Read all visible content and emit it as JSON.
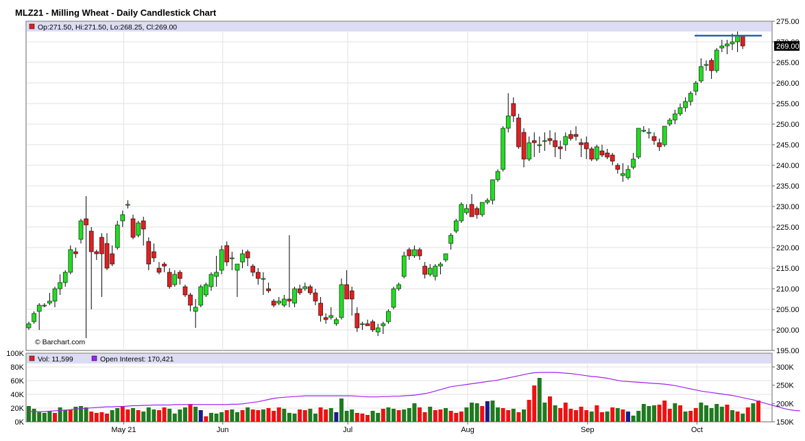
{
  "title": "MLZ21 - Milling Wheat - Daily Candlestick Chart",
  "price_info": "Op:271.50, Hi:271.50, Lo:268.25, Cl:269.00",
  "last_price": "269.00",
  "volume_info": "Vol: 11,599",
  "oi_info": "Open Interest: 170,421",
  "watermark": "© Barchart.com",
  "colors": {
    "up": "#22dd22",
    "down": "#e02020",
    "vol_up": "#1f7a1f",
    "vol_down": "#ee1111",
    "vol_flat": "#1a1a8c",
    "oi": "#a020f0",
    "line": "#2d5fa8",
    "info_band": "#dcdcf5"
  },
  "chart_data": [
    {
      "type": "candlestick",
      "title": "MLZ21 - Milling Wheat - Daily Candlestick Chart",
      "ylim": [
        195,
        275
      ],
      "yticks": [
        "275.00",
        "270.00",
        "265.00",
        "260.00",
        "255.00",
        "250.00",
        "245.00",
        "240.00",
        "235.00",
        "230.00",
        "225.00",
        "220.00",
        "215.00",
        "210.00",
        "205.00",
        "200.00",
        "195.00"
      ],
      "xticks": [
        "May 21",
        "Jun",
        "Jul",
        "Aug",
        "Sep",
        "Oct"
      ],
      "horizontal_line": 271.5,
      "candles": [
        [
          200.5,
          202.0,
          200.0,
          201.5
        ],
        [
          202.0,
          204.5,
          201.5,
          204.0
        ],
        [
          204.5,
          206.5,
          200.0,
          206.0
        ],
        [
          206.0,
          206.5,
          205.5,
          206.0
        ],
        [
          206.5,
          209.0,
          206.0,
          207.0
        ],
        [
          207.0,
          210.5,
          205.5,
          210.0
        ],
        [
          210.0,
          213.5,
          208.5,
          211.5
        ],
        [
          211.5,
          214.5,
          210.5,
          214.0
        ],
        [
          214.0,
          220.5,
          213.5,
          219.5
        ],
        [
          219.0,
          220.0,
          217.5,
          218.5
        ],
        [
          222.0,
          227.0,
          221.0,
          226.5
        ],
        [
          227.0,
          232.5,
          198.0,
          225.5
        ],
        [
          224.0,
          225.0,
          205.0,
          219.0
        ],
        [
          219.0,
          219.5,
          217.0,
          218.5
        ],
        [
          222.5,
          223.5,
          208.0,
          218.5
        ],
        [
          221.0,
          223.5,
          214.5,
          215.0
        ],
        [
          218.5,
          220.5,
          215.5,
          216.0
        ],
        [
          220.0,
          226.5,
          219.5,
          225.5
        ],
        [
          226.5,
          229.0,
          225.0,
          228.0
        ],
        [
          230.5,
          231.5,
          229.5,
          230.5
        ],
        [
          227.0,
          228.0,
          222.0,
          222.5
        ],
        [
          223.0,
          226.5,
          222.5,
          226.0
        ],
        [
          226.5,
          227.5,
          220.5,
          224.5
        ],
        [
          221.5,
          222.5,
          214.5,
          216.0
        ],
        [
          219.0,
          221.0,
          216.5,
          217.5
        ],
        [
          215.0,
          216.5,
          213.5,
          214.0
        ],
        [
          216.0,
          216.5,
          214.0,
          215.5
        ],
        [
          214.0,
          215.0,
          210.0,
          210.5
        ],
        [
          211.0,
          214.5,
          210.5,
          213.5
        ],
        [
          214.0,
          214.5,
          211.0,
          212.5
        ],
        [
          210.5,
          211.0,
          208.0,
          208.5
        ],
        [
          208.5,
          209.0,
          204.5,
          206.0
        ],
        [
          204.5,
          207.5,
          200.5,
          205.5
        ],
        [
          206.0,
          211.0,
          205.5,
          210.5
        ],
        [
          208.5,
          211.5,
          208.0,
          211.0
        ],
        [
          210.5,
          214.0,
          209.5,
          213.5
        ],
        [
          213.0,
          218.0,
          210.5,
          214.0
        ],
        [
          214.5,
          220.5,
          213.5,
          219.5
        ],
        [
          220.5,
          221.5,
          215.5,
          216.5
        ],
        [
          217.5,
          219.0,
          214.5,
          217.5
        ],
        [
          214.5,
          215.5,
          208.0,
          216.0
        ],
        [
          216.5,
          219.5,
          215.0,
          218.5
        ],
        [
          219.0,
          219.5,
          215.5,
          217.5
        ],
        [
          215.5,
          216.0,
          213.0,
          214.0
        ],
        [
          214.0,
          215.0,
          211.0,
          212.5
        ],
        [
          212.5,
          214.0,
          208.5,
          212.5
        ],
        [
          210.0,
          211.5,
          209.0,
          209.5
        ],
        [
          207.0,
          207.5,
          205.5,
          206.0
        ],
        [
          206.5,
          208.0,
          206.0,
          207.0
        ],
        [
          206.0,
          208.5,
          205.5,
          207.5
        ],
        [
          207.5,
          223.0,
          205.5,
          207.0
        ],
        [
          206.5,
          210.5,
          205.5,
          210.0
        ],
        [
          210.0,
          211.0,
          208.5,
          209.0
        ],
        [
          210.0,
          211.5,
          209.5,
          210.5
        ],
        [
          210.5,
          211.0,
          208.5,
          209.0
        ],
        [
          209.0,
          210.0,
          206.0,
          207.0
        ],
        [
          206.5,
          208.0,
          202.0,
          203.5
        ],
        [
          203.0,
          204.0,
          201.5,
          202.5
        ],
        [
          203.0,
          205.5,
          202.5,
          203.5
        ],
        [
          201.5,
          203.0,
          201.0,
          202.5
        ],
        [
          203.0,
          212.5,
          202.5,
          211.0
        ],
        [
          211.0,
          214.5,
          207.5,
          207.5
        ],
        [
          209.5,
          210.5,
          203.5,
          207.5
        ],
        [
          204.0,
          205.5,
          199.5,
          200.5
        ],
        [
          201.5,
          202.0,
          200.0,
          201.5
        ],
        [
          201.5,
          202.5,
          201.0,
          201.0
        ],
        [
          202.0,
          202.5,
          199.5,
          200.0
        ],
        [
          199.5,
          201.5,
          198.5,
          200.5
        ],
        [
          201.0,
          202.0,
          199.0,
          201.5
        ],
        [
          202.0,
          205.0,
          201.5,
          204.5
        ],
        [
          205.5,
          210.5,
          205.0,
          210.0
        ],
        [
          210.0,
          211.5,
          209.5,
          211.0
        ],
        [
          213.0,
          219.0,
          212.5,
          218.0
        ],
        [
          219.5,
          220.0,
          217.0,
          218.0
        ],
        [
          218.0,
          220.5,
          217.5,
          219.5
        ],
        [
          219.5,
          220.0,
          217.0,
          218.0
        ],
        [
          215.5,
          216.5,
          212.5,
          213.5
        ],
        [
          213.5,
          216.0,
          213.0,
          215.0
        ],
        [
          213.0,
          216.0,
          212.0,
          215.5
        ],
        [
          215.5,
          216.5,
          213.5,
          216.0
        ],
        [
          217.0,
          218.5,
          216.5,
          218.5
        ],
        [
          221.0,
          223.5,
          219.5,
          223.0
        ],
        [
          224.0,
          227.0,
          223.5,
          226.5
        ],
        [
          226.5,
          231.0,
          226.0,
          230.5
        ],
        [
          228.5,
          230.5,
          228.0,
          229.5
        ],
        [
          230.5,
          233.0,
          227.5,
          227.5
        ],
        [
          229.5,
          230.0,
          227.0,
          228.0
        ],
        [
          228.0,
          231.0,
          227.5,
          231.0
        ],
        [
          231.0,
          232.0,
          230.5,
          231.5
        ],
        [
          231.5,
          236.5,
          230.5,
          236.5
        ],
        [
          236.5,
          239.0,
          236.0,
          238.5
        ],
        [
          239.0,
          249.5,
          238.5,
          249.0
        ],
        [
          249.0,
          257.5,
          248.0,
          252.0
        ],
        [
          255.0,
          256.5,
          250.5,
          252.0
        ],
        [
          251.5,
          252.5,
          244.0,
          244.5
        ],
        [
          248.0,
          249.0,
          239.5,
          241.5
        ],
        [
          241.5,
          247.0,
          241.0,
          245.5
        ],
        [
          246.0,
          248.0,
          242.0,
          245.5
        ],
        [
          245.0,
          247.0,
          243.0,
          245.0
        ],
        [
          246.0,
          248.0,
          243.5,
          246.0
        ],
        [
          246.5,
          248.5,
          245.0,
          246.0
        ],
        [
          246.0,
          248.0,
          242.0,
          244.5
        ],
        [
          244.5,
          246.0,
          241.5,
          244.0
        ],
        [
          245.0,
          248.0,
          243.5,
          247.0
        ],
        [
          247.5,
          248.5,
          246.0,
          246.5
        ],
        [
          247.5,
          249.5,
          246.0,
          247.0
        ],
        [
          245.5,
          246.5,
          242.0,
          245.0
        ],
        [
          245.5,
          247.0,
          241.5,
          244.0
        ],
        [
          244.0,
          244.5,
          241.0,
          241.5
        ],
        [
          241.5,
          245.0,
          241.0,
          244.5
        ],
        [
          243.5,
          245.0,
          242.0,
          242.5
        ],
        [
          243.0,
          244.0,
          241.5,
          242.0
        ],
        [
          242.5,
          243.0,
          240.0,
          241.0
        ],
        [
          240.0,
          240.5,
          238.0,
          239.0
        ],
        [
          237.5,
          240.5,
          236.0,
          238.0
        ],
        [
          237.0,
          240.0,
          236.5,
          239.0
        ],
        [
          239.5,
          243.0,
          239.0,
          241.5
        ],
        [
          242.0,
          249.0,
          241.5,
          249.0
        ],
        [
          248.5,
          249.5,
          248.0,
          248.5
        ],
        [
          248.0,
          249.0,
          246.5,
          248.0
        ],
        [
          247.0,
          248.0,
          245.0,
          246.0
        ],
        [
          245.5,
          246.5,
          243.5,
          244.5
        ],
        [
          245.0,
          249.5,
          244.5,
          249.5
        ],
        [
          250.0,
          251.5,
          249.5,
          251.0
        ],
        [
          251.0,
          253.5,
          250.0,
          252.5
        ],
        [
          252.5,
          255.0,
          252.0,
          254.0
        ],
        [
          254.0,
          256.5,
          253.0,
          255.5
        ],
        [
          255.5,
          258.0,
          254.5,
          257.5
        ],
        [
          258.0,
          260.5,
          257.0,
          260.0
        ],
        [
          260.5,
          266.0,
          260.0,
          264.0
        ],
        [
          264.5,
          265.5,
          263.0,
          264.5
        ],
        [
          265.5,
          266.0,
          261.0,
          263.0
        ],
        [
          263.0,
          268.5,
          262.5,
          268.0
        ],
        [
          268.5,
          270.5,
          267.5,
          269.0
        ],
        [
          269.0,
          270.5,
          267.0,
          269.5
        ],
        [
          269.5,
          272.0,
          268.0,
          270.0
        ],
        [
          270.0,
          272.5,
          267.5,
          271.5
        ],
        [
          271.5,
          271.5,
          268.25,
          269.0
        ]
      ],
      "ylabel": ""
    },
    {
      "type": "bar",
      "title": "",
      "series_name": "Vol",
      "ylim": [
        0,
        100000
      ],
      "yticks_left": [
        "100K",
        "80K",
        "60K",
        "40K",
        "20K",
        "0K"
      ],
      "yticks_right": [
        "300K",
        "250K",
        "200K",
        "150K"
      ],
      "volumes_k": [
        23,
        19,
        14,
        13,
        16,
        13,
        21,
        17,
        18,
        22,
        23,
        21,
        15,
        13,
        14,
        12,
        17,
        20,
        22,
        18,
        20,
        17,
        15,
        21,
        18,
        17,
        21,
        19,
        12,
        18,
        21,
        26,
        22,
        17,
        8,
        13,
        12,
        14,
        17,
        18,
        14,
        17,
        21,
        18,
        17,
        18,
        20,
        16,
        21,
        19,
        13,
        12,
        18,
        17,
        19,
        12,
        21,
        18,
        20,
        14,
        34,
        16,
        18,
        13,
        12,
        10,
        16,
        13,
        19,
        21,
        19,
        17,
        18,
        20,
        27,
        21,
        14,
        22,
        17,
        18,
        20,
        16,
        13,
        15,
        21,
        28,
        27,
        23,
        30,
        31,
        21,
        20,
        17,
        19,
        14,
        18,
        32,
        53,
        64,
        28,
        37,
        24,
        20,
        28,
        19,
        17,
        22,
        17,
        15,
        24,
        14,
        15,
        21,
        20,
        18,
        15,
        9,
        16,
        26,
        23,
        24,
        25,
        31,
        19,
        27,
        24,
        15,
        16,
        20,
        28,
        24,
        20,
        26,
        22,
        25,
        17,
        15,
        12,
        21,
        27,
        31
      ],
      "volume_colors": "gggggrggrgggrrrrggrrgrgggrrggggrgbrgggrggrgrrgrrrgggrrggrrgbgggrrrggrggrgggrrgrrgrrrgggrbggrrgrgrrggrgrrrrrrgrrgrgrbgggggrrrgrgrrgggggrgrgrgrgggrr",
      "open_interest_k": [
        178,
        178,
        178,
        178,
        179,
        180,
        181,
        182,
        183,
        185,
        186,
        187,
        188,
        189,
        190,
        191,
        191,
        192,
        192,
        193,
        194,
        194,
        195,
        195,
        196,
        196,
        196,
        196,
        197,
        197,
        197,
        197,
        197,
        197,
        197,
        197,
        197,
        197,
        197,
        198,
        198,
        199,
        201,
        203,
        205,
        208,
        211,
        214,
        216,
        217,
        218,
        219,
        220,
        221,
        221,
        221,
        221,
        221,
        221,
        221,
        221,
        221,
        221,
        220,
        219,
        218,
        218,
        218,
        219,
        219,
        220,
        220,
        221,
        222,
        223,
        225,
        227,
        230,
        234,
        238,
        242,
        246,
        248,
        250,
        252,
        254,
        256,
        258,
        260,
        262,
        264,
        267,
        270,
        273,
        276,
        279,
        282,
        284,
        285,
        285,
        285,
        285,
        284,
        283,
        282,
        280,
        278,
        276,
        274,
        273,
        271,
        269,
        266,
        263,
        261,
        260,
        259,
        258,
        257,
        256,
        255,
        254,
        253,
        251,
        249,
        246,
        243,
        240,
        237,
        234,
        232,
        230,
        228,
        226,
        224,
        222,
        219,
        216,
        213,
        210,
        206,
        202,
        198,
        194,
        190,
        186,
        183,
        181,
        180
      ]
    }
  ]
}
